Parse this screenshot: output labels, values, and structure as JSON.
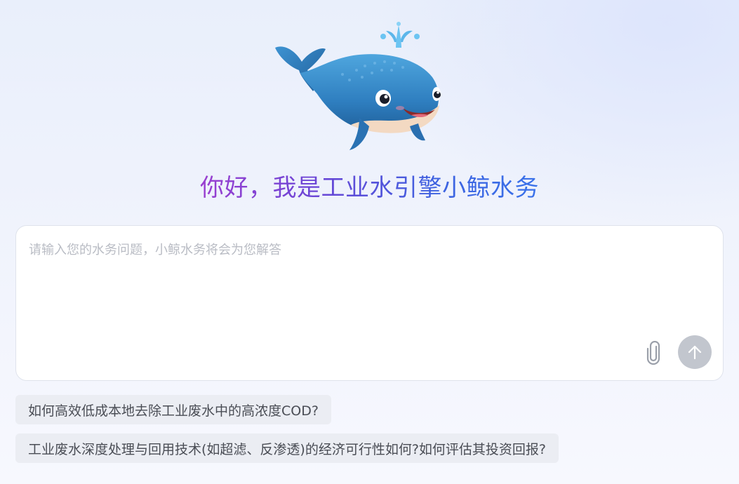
{
  "mascot": {
    "icon": "whale-mascot-icon"
  },
  "greeting": {
    "text": "你好，我是工业水引擎小鲸水务"
  },
  "composer": {
    "placeholder": "请输入您的水务问题，小鲸水务将会为您解答",
    "value": "",
    "attach_icon": "paperclip-icon",
    "send_icon": "arrow-up-icon"
  },
  "suggestions": [
    {
      "text": "如何高效低成本地去除工业废水中的高浓度COD?"
    },
    {
      "text": "工业废水深度处理与回用技术(如超滤、反渗透)的经济可行性如何?如何评估其投资回报?"
    }
  ],
  "colors": {
    "greeting_gradient_start": "#9a3fd0",
    "greeting_gradient_end": "#3a72ea",
    "send_button_disabled": "#c2c6ce",
    "suggestion_bg": "#ebedf3",
    "placeholder": "#b9bcc4"
  }
}
